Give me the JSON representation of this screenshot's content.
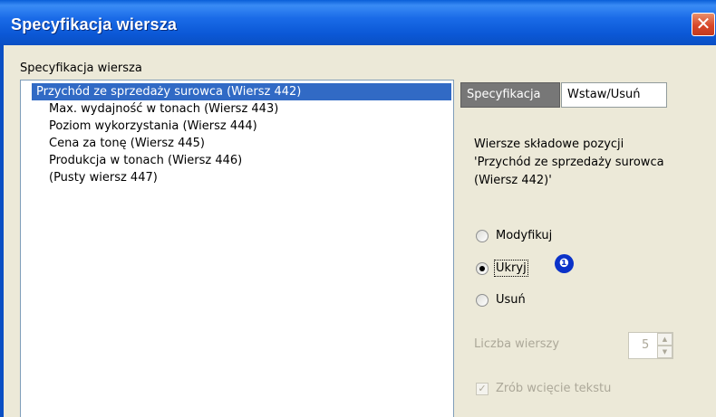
{
  "window": {
    "title": "Specyfikacja wiersza",
    "close_glyph": "✕"
  },
  "group_label": "Specyfikacja wiersza",
  "tree": {
    "items": [
      "Przychód ze sprzedaży surowca (Wiersz 442)",
      "Max. wydajność w tonach (Wiersz 443)",
      "Poziom wykorzystania (Wiersz 444)",
      "Cena za tonę (Wiersz 445)",
      "Produkcja w tonach (Wiersz 446)",
      "(Pusty wiersz 447)"
    ]
  },
  "tabs": [
    "Specyfikacja",
    "Wstaw/Usuń"
  ],
  "description": [
    "Wiersze składowe pozycji",
    "'Przychód ze sprzedaży surowca",
    "(Wiersz 442)'"
  ],
  "options": {
    "modify": "Modyfikuj",
    "hide": "Ukryj",
    "delete": "Usuń",
    "selected": "Ukryj"
  },
  "badge": "❶",
  "row_count": {
    "label": "Liczba wierszy",
    "value": "5"
  },
  "indent_checkbox": {
    "label": "Zrób wcięcie tekstu",
    "checked": true
  }
}
